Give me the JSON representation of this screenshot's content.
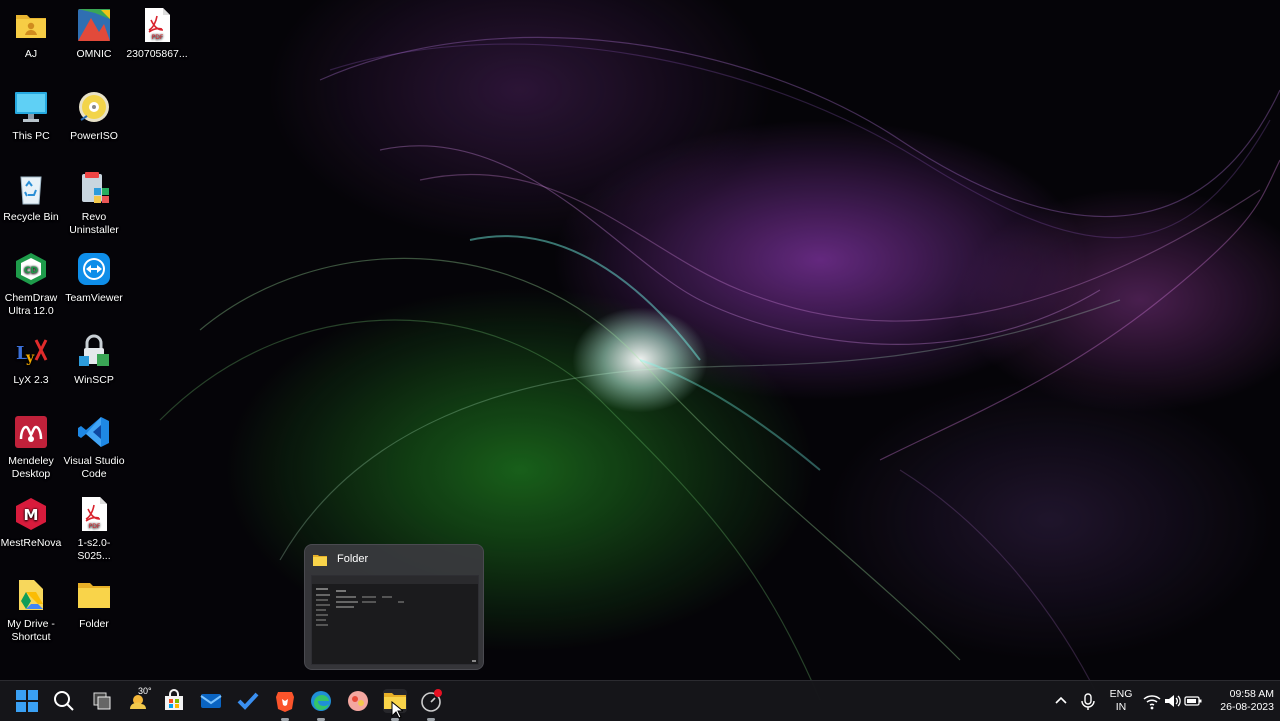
{
  "desktop": {
    "icons": [
      {
        "label": "AJ"
      },
      {
        "label": "OMNIC"
      },
      {
        "label": "230705867..."
      },
      {
        "label": "This PC"
      },
      {
        "label": "PowerISO"
      },
      {
        "label": "Recycle Bin"
      },
      {
        "label": "Revo Uninstaller"
      },
      {
        "label": "ChemDraw Ultra 12.0"
      },
      {
        "label": "TeamViewer"
      },
      {
        "label": "LyX 2.3"
      },
      {
        "label": "WinSCP"
      },
      {
        "label": "Mendeley Desktop"
      },
      {
        "label": "Visual Studio Code"
      },
      {
        "label": "MestReNova"
      },
      {
        "label": "1-s2.0-S025..."
      },
      {
        "label": "My Drive - Shortcut"
      },
      {
        "label": "Folder"
      }
    ]
  },
  "preview": {
    "title": "Folder"
  },
  "taskbar": {
    "weather_temp": "30°",
    "tray": {
      "lang_line1": "ENG",
      "lang_line2": "IN",
      "time": "09:58 AM",
      "date": "26-08-2023"
    }
  },
  "colors": {
    "taskbar_bg": "#16161a",
    "accent_blue": "#0078d4",
    "folder_yellow": "#f5c542"
  }
}
